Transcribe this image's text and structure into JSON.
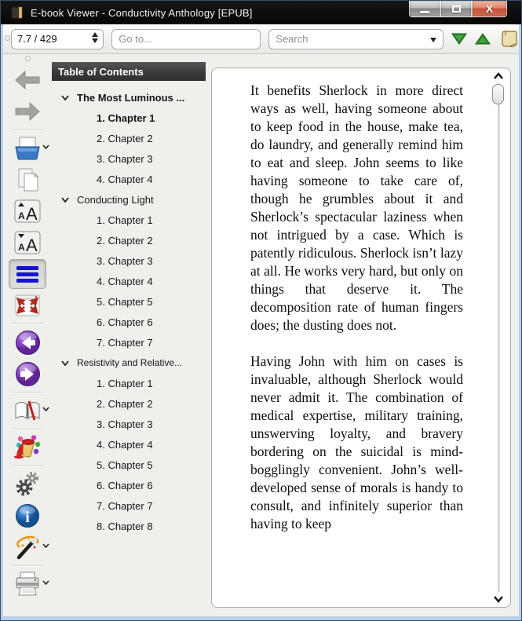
{
  "window": {
    "title": "E-book Viewer - Conductivity Anthology [EPUB]",
    "controls": {
      "minimize": "minimize",
      "maximize": "maximize",
      "close": "close",
      "close_glyph": "X"
    }
  },
  "toolbar": {
    "position_value": "7.7 / 429",
    "goto_placeholder": "Go to...",
    "search_placeholder": "Search",
    "icons": [
      "find-next-icon",
      "find-previous-icon",
      "toggle-paged-mode-icon"
    ]
  },
  "sidebar": {
    "icons": [
      "back-icon",
      "forward-icon",
      "open-ebook-icon",
      "copy-icon",
      "font-size-larger-icon",
      "font-size-smaller-icon",
      "table-of-contents-icon",
      "fullscreen-icon",
      "previous-page-icon",
      "next-page-icon",
      "bookmark-icon",
      "color-scheme-icon",
      "preferences-icon",
      "book-info-icon",
      "reference-mode-icon",
      "print-icon"
    ],
    "toc_pressed": true
  },
  "toc": {
    "header": "Table of Contents",
    "items": [
      {
        "label": "The Most Luminous ...",
        "level": 0,
        "bold": true
      },
      {
        "label": "1. Chapter 1",
        "level": 1,
        "bold": true
      },
      {
        "label": "2. Chapter 2",
        "level": 1,
        "bold": false
      },
      {
        "label": "3. Chapter 3",
        "level": 1,
        "bold": false
      },
      {
        "label": "4. Chapter 4",
        "level": 1,
        "bold": false
      },
      {
        "label": "Conducting Light",
        "level": 0,
        "bold": false
      },
      {
        "label": "1. Chapter 1",
        "level": 1,
        "bold": false
      },
      {
        "label": "2. Chapter 2",
        "level": 1,
        "bold": false
      },
      {
        "label": "3. Chapter 3",
        "level": 1,
        "bold": false
      },
      {
        "label": "4. Chapter 4",
        "level": 1,
        "bold": false
      },
      {
        "label": "5. Chapter 5",
        "level": 1,
        "bold": false
      },
      {
        "label": "6. Chapter 6",
        "level": 1,
        "bold": false
      },
      {
        "label": "7. Chapter 7",
        "level": 1,
        "bold": false
      },
      {
        "label": "Resistivity and Relative...",
        "level": 0,
        "bold": false
      },
      {
        "label": "1. Chapter 1",
        "level": 1,
        "bold": false
      },
      {
        "label": "2. Chapter 2",
        "level": 1,
        "bold": false
      },
      {
        "label": "3. Chapter 3",
        "level": 1,
        "bold": false
      },
      {
        "label": "4. Chapter 4",
        "level": 1,
        "bold": false
      },
      {
        "label": "5. Chapter 5",
        "level": 1,
        "bold": false
      },
      {
        "label": "6. Chapter 6",
        "level": 1,
        "bold": false
      },
      {
        "label": "7. Chapter 7",
        "level": 1,
        "bold": false
      },
      {
        "label": "8. Chapter 8",
        "level": 1,
        "bold": false
      }
    ]
  },
  "content": {
    "paragraphs": [
      "It benefits Sherlock in more direct ways as well, having someone about to keep food in the house, make tea, do laundry, and generally remind him to eat and sleep. John seems to like having someone to take care of, though he grumbles about it and Sherlock’s spectacular laziness when not intrigued by a case. Which is patently ridiculous. Sherlock isn’t lazy at all. He works very hard, but only on things that deserve it. The decomposition rate of human fingers does; the dusting does not.",
      "Having John with him on cases is invaluable, although Sherlock would never admit it. The combination of medical expertise, military training, unswerving loyalty, and bravery bordering on the suicidal is mind-bogglingly convenient. John’s well-developed sense of morals is handy to consult, and infinitely superior than having to keep"
    ]
  },
  "colors": {
    "titlebar": "#0a0a0a",
    "window_border": "#b9cfe6",
    "toc_header_bg": "#3a3a3a",
    "accent_blue": "#2b6cb8",
    "nav_green": "#2e8b2e",
    "page_bg": "#ffffff"
  }
}
